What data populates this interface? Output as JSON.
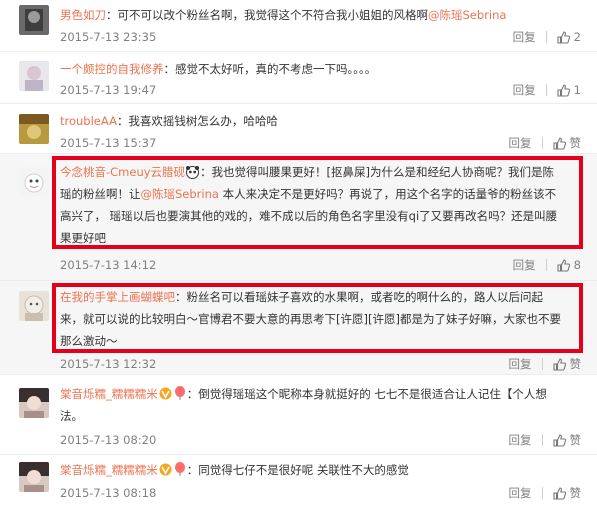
{
  "comments": [
    {
      "username": "男色如刀",
      "text": "：可不可以改个粉丝名啊，我觉得这个不符合我小姐姐的风格啊",
      "mention": "@陈瑶Sebrina",
      "time": "2015-7-13 23:35",
      "reply_label": "回复",
      "like_label": "2"
    },
    {
      "username": "一个颇控的自我修养",
      "text": "：感觉不太好听，真的不考虑一下吗。。。。",
      "time": "2015-7-13 19:47",
      "reply_label": "回复",
      "like_label": "1"
    },
    {
      "username": "troubleAA",
      "text": "：我喜欢摇钱树怎么办，哈哈哈",
      "time": "2015-7-13 15:37",
      "reply_label": "回复",
      "like_label": "赞"
    },
    {
      "username": "今念桃音-Cmeuy云腊砚",
      "text_a": "：我也觉得叫腰果更好！[抠鼻屎]为什么是和经纪人协商呢？我们是陈",
      "text_b": "瑶的粉丝啊！让",
      "mention": "@陈瑶Sebrina",
      "text_c": " 本人来决定不是更好吗？再说了，用这个名字的话量爷的粉丝该不",
      "text_d": "高兴了，  瑶瑶以后也要演其他的戏的，难不成以后的角色名字里没有qi了又要再改名吗？还是叫腰",
      "text_e": "果更好吧",
      "time": "2015-7-13 14:12",
      "reply_label": "回复",
      "like_label": "8"
    },
    {
      "username": "在我的手掌上画蝴蝶吧",
      "text_a": "：粉丝名可以看瑶妹子喜欢的水果啊，或者吃的啊什么的，路人以后问起",
      "text_b": "来，就可以说的比较明白～官博君不要大意的再思考下[许愿][许愿]都是为了妹子好嘛，大家也不要",
      "text_c": "那么激动～",
      "time": "2015-7-13 12:32",
      "reply_label": "回复",
      "like_label": "赞"
    },
    {
      "username": "棠音烁糯_糯糯糯米",
      "text_a": "：倒觉得瑶瑶这个昵称本身就挺好的 七七不是很适合让人记住【个人想",
      "text_b": "法。",
      "time": "2015-7-13 08:20",
      "reply_label": "回复",
      "like_label": "赞"
    },
    {
      "username": "棠音烁糯_糯糯糯米",
      "text": "：同觉得七仔不是很好呢 关联性不大的感觉",
      "time": "2015-7-13 08:18",
      "reply_label": "回复",
      "like_label": "赞"
    }
  ],
  "colors": {
    "username": "#eb7350",
    "highlight_box": "#e2001a",
    "meta": "#808080"
  }
}
